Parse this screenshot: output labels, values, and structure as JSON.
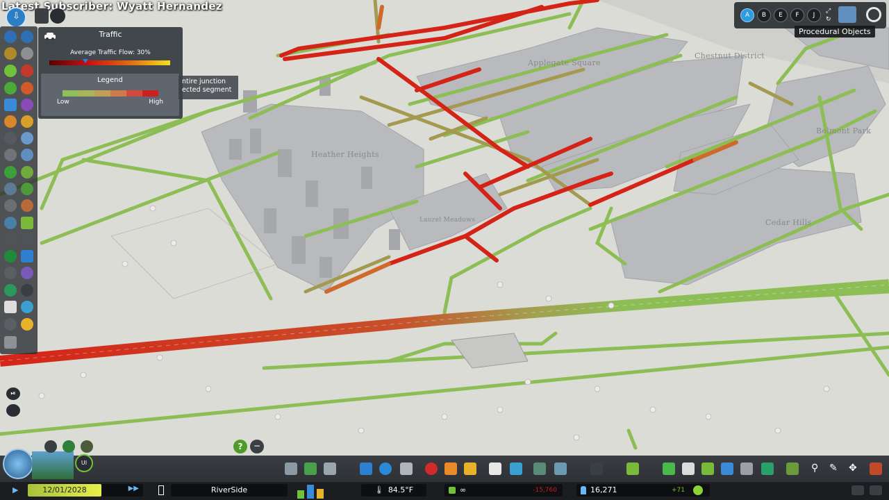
{
  "overlay": {
    "subscriber_text": "Latest Subscriber: Wyatt Hernandez"
  },
  "districts": [
    {
      "name": "Chestnut District"
    },
    {
      "name": "Applegate Square"
    },
    {
      "name": "Heather Heights"
    },
    {
      "name": "Belmont Park"
    },
    {
      "name": "Laurel Meadows"
    },
    {
      "name": "Cedar Hills"
    }
  ],
  "traffic_panel": {
    "title": "Traffic",
    "flow_label": "Average Traffic Flow: 30%",
    "flow_value": 0.3,
    "legend_title": "Legend",
    "legend_low": "Low",
    "legend_high": "High",
    "legend_colors": [
      "#8fbf5a",
      "#a9b35a",
      "#c0a058",
      "#d07a4a",
      "#d24a3e",
      "#cc2020"
    ]
  },
  "tooltip": {
    "line1": "ntire junction",
    "line2": "ected segment"
  },
  "layers": {
    "buttons": [
      "A",
      "B",
      "E",
      "F",
      "J"
    ],
    "active": "A"
  },
  "procedural_objects_label": "Procedural Objects",
  "info_bar": {
    "date": "12/01/2028",
    "city": "RiverSide",
    "temperature": "84.5°F",
    "money": "∞",
    "income": "-15,760",
    "population": "16,271",
    "pop_change": "+71"
  },
  "colors": {
    "ground": "#dcdcd7",
    "road_green": "#8dbd55",
    "road_red": "#d42418",
    "road_orange": "#cf6a2c",
    "road_olive": "#a39a50",
    "building": "#b7b8bc",
    "panel_bg": "#343a40"
  },
  "icons": {
    "toolbar_left": [
      "roads-icon",
      "water-icon",
      "zoning-icon",
      "districts-icon",
      "electricity-icon",
      "garbage-icon",
      "health-icon",
      "fire-icon",
      "police-icon",
      "education-icon",
      "transport-icon",
      "parks-icon",
      "unique-icon",
      "monuments-icon",
      "wonders-icon",
      "tools-icon",
      "move-it-icon",
      "traffic-icon",
      "info-icon",
      "settings-icon"
    ]
  }
}
